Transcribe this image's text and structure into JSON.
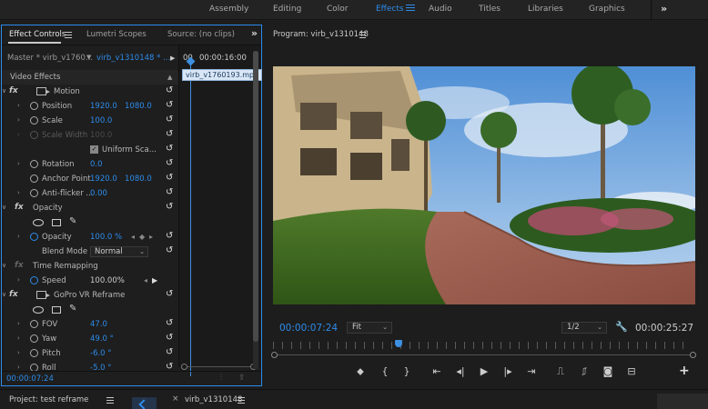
{
  "workspaces": {
    "items": [
      "Assembly",
      "Editing",
      "Color",
      "Effects",
      "Audio",
      "Titles",
      "Libraries",
      "Graphics"
    ],
    "active": "Effects",
    "more": "»"
  },
  "effect_controls": {
    "tabs": [
      "Effect Controls",
      "Lumetri Scopes",
      "Source: (no clips)"
    ],
    "more": "»",
    "master_label": "Master * virb_v1760...",
    "sequence_label": "virb_v1310148 * ...",
    "timeline": {
      "start_time": "00",
      "end_time": "00:00:16:00",
      "clip_name": "virb_v1760193.mp4"
    },
    "section_video_effects": "Video Effects",
    "motion": {
      "label": "Motion",
      "position": {
        "label": "Position",
        "x": "1920.0",
        "y": "1080.0"
      },
      "scale": {
        "label": "Scale",
        "value": "100.0"
      },
      "scale_width": {
        "label": "Scale Width",
        "value": "100.0"
      },
      "uniform_scale": {
        "label": "Uniform Sca...",
        "checked": true,
        "check_glyph": "✓"
      },
      "rotation": {
        "label": "Rotation",
        "value": "0.0"
      },
      "anchor_point": {
        "label": "Anchor Point",
        "x": "1920.0",
        "y": "1080.0"
      },
      "anti_flicker": {
        "label": "Anti-flicker ...",
        "value": "0.00"
      }
    },
    "opacity": {
      "label": "Opacity",
      "opacity": {
        "label": "Opacity",
        "value": "100.0 %"
      },
      "blend_mode": {
        "label": "Blend Mode",
        "value": "Normal"
      }
    },
    "time_remapping": {
      "label": "Time Remapping",
      "speed": {
        "label": "Speed",
        "value": "100.00%"
      }
    },
    "gopro": {
      "label": "GoPro VR Reframe",
      "fov": {
        "label": "FOV",
        "value": "47.0"
      },
      "yaw": {
        "label": "Yaw",
        "value": "49.0 °"
      },
      "pitch": {
        "label": "Pitch",
        "value": "-6.0 °"
      },
      "roll": {
        "label": "Roll",
        "value": "-5.0 °"
      }
    },
    "footer_time": "00:00:07:24"
  },
  "program": {
    "title": "Program: virb_v1310148",
    "current_time": "00:00:07:24",
    "zoom": "Fit",
    "resolution": "1/2",
    "duration": "00:00:25:27",
    "playhead_fraction": 0.3
  },
  "bottom": {
    "project": "Project: test reframe",
    "sequence": "virb_v1310148",
    "close": "×"
  },
  "colors": {
    "accent": "#2d8ceb",
    "panel_bg": "#1e1e1e"
  }
}
